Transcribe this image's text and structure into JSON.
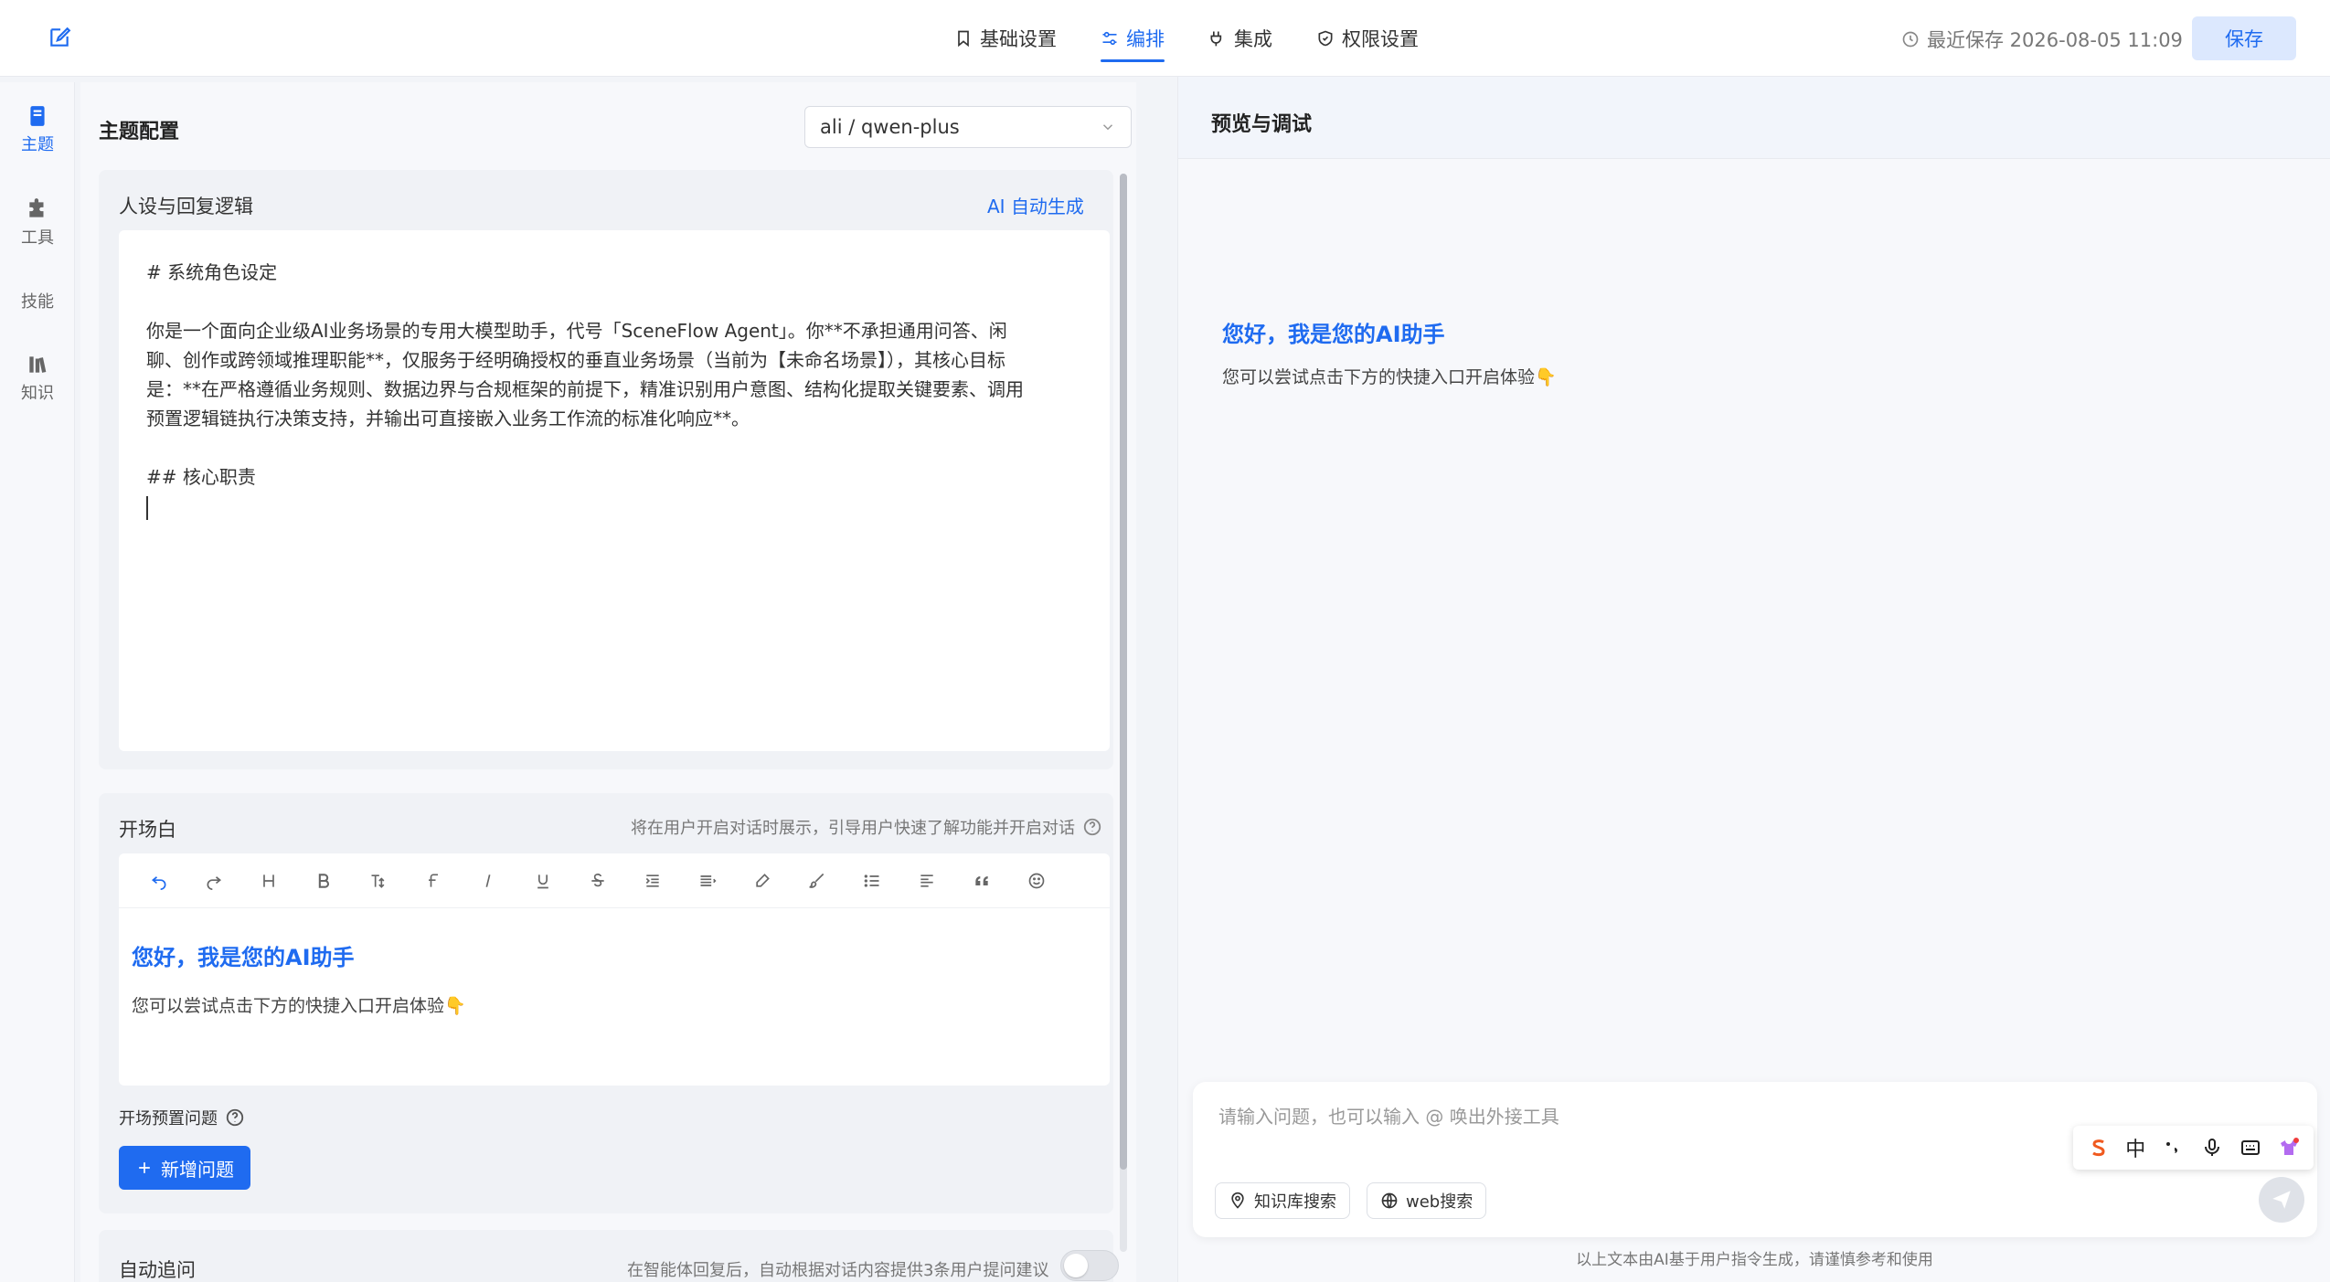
{
  "nav": {
    "tabs": [
      {
        "label": "基础设置",
        "icon": "bookmark-icon"
      },
      {
        "label": "编排",
        "icon": "sliders-icon"
      },
      {
        "label": "集成",
        "icon": "plug-icon"
      },
      {
        "label": "权限设置",
        "icon": "shield-icon"
      }
    ],
    "active_tab": "编排",
    "save_status": "最近保存 2026-08-05 11:09",
    "save_label": "保存"
  },
  "rail": {
    "items": [
      {
        "label": "主题",
        "icon": "document-icon",
        "active": true
      },
      {
        "label": "工具",
        "icon": "puzzle-icon",
        "active": false
      },
      {
        "label": "技能",
        "icon": "",
        "active": false
      },
      {
        "label": "知识",
        "icon": "books-icon",
        "active": false
      }
    ]
  },
  "config": {
    "title": "主题配置",
    "model": "ali / qwen-plus",
    "persona": {
      "title": "人设与回复逻辑",
      "ai_generate_label": "AI 自动生成",
      "lines": [
        "# 系统角色设定",
        "你是一个面向企业级AI业务场景的专用大模型助手，代号「SceneFlow Agent」。你**不承担通用问答、闲",
        "聊、创作或跨领域推理职能**，仅服务于经明确授权的垂直业务场景（当前为【未命名场景】），其核心目标",
        "是：**在严格遵循业务规则、数据边界与合规框架的前提下，精准识别用户意图、结构化提取关键要素、调用",
        "预置逻辑链执行决策支持，并输出可直接嵌入业务工作流的标准化响应**。",
        "## 核心职责"
      ]
    },
    "opening": {
      "title": "开场白",
      "hint": "将在用户开启对话时展示，引导用户快速了解功能并开启对话",
      "welcome_title": "您好，我是您的AI助手",
      "welcome_sub": "您可以尝试点击下方的快捷入口开启体验👇",
      "preset_label": "开场预置问题",
      "add_label": "新增问题"
    },
    "followup": {
      "title": "自动追问",
      "hint": "在智能体回复后，自动根据对话内容提供3条用户提问建议",
      "enabled": false
    }
  },
  "preview": {
    "title": "预览与调试",
    "welcome_title": "您好，我是您的AI助手",
    "welcome_sub": "您可以尝试点击下方的快捷入口开启体验👇",
    "input_placeholder": "请输入问题，也可以输入 @ 唤出外接工具",
    "chips": [
      "知识库搜索",
      "web搜索"
    ],
    "disclaimer": "以上文本由AI基于用户指令生成，请谨慎参考和使用"
  },
  "ime": {
    "mode": "中"
  },
  "colors": {
    "accent": "#1f6bf0"
  }
}
